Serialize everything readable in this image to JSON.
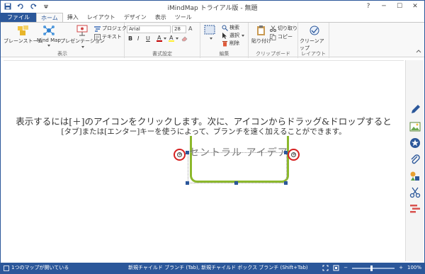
{
  "titlebar": {
    "title": "iMindMap トライアル版 - 無題",
    "help": "?",
    "minimize": "─",
    "restore": "☐",
    "close": "✕"
  },
  "tabs": [
    {
      "label": "ファイル"
    },
    {
      "label": "ホーム"
    },
    {
      "label": "挿入"
    },
    {
      "label": "レイアウト"
    },
    {
      "label": "デザイン"
    },
    {
      "label": "表示"
    },
    {
      "label": "ツール"
    }
  ],
  "ribbon": {
    "view_group": {
      "label": "表示",
      "brainstorm": "ブレーンストーム",
      "mindmap": "Mind Map",
      "presentation": "プレゼンテーション",
      "project": "プロジェクト",
      "text": "テキスト"
    },
    "format_group": {
      "label": "書式設定",
      "font": "Arial",
      "size": "28",
      "bold": "B",
      "italic": "I",
      "underline": "U"
    },
    "edit_group": {
      "label": "編集",
      "search": "検索",
      "select": "選択",
      "delete": "削除"
    },
    "clipboard_group": {
      "label": "クリップボード",
      "paste": "貼り付け",
      "cut": "切り取り",
      "copy": "コピー"
    },
    "layout_group": {
      "label": "レイアウト",
      "cleanup": "クリーンアップ"
    }
  },
  "canvas": {
    "hint_line1": "表示するには[＋]のアイコンをクリックします。次に、アイコンからドラッグ&ドロップすると",
    "hint_line2": "[タブ]または[エンター]キーを使うによって、ブランチを速く加えることができます。",
    "central_topic": "セントラル アイデア",
    "plus_symbol": "+"
  },
  "statusbar": {
    "left": "1つのマップが開いている",
    "center": "新規チャイルド ブランチ (Tab), 新規チャイルド ボックス ブランチ (Shift+Tab)",
    "minus": "−",
    "plus": "+",
    "zoom": "100%"
  },
  "colors": {
    "accent": "#2b579a",
    "branch_green": "#8cb82c",
    "plus_red": "#d62020"
  }
}
